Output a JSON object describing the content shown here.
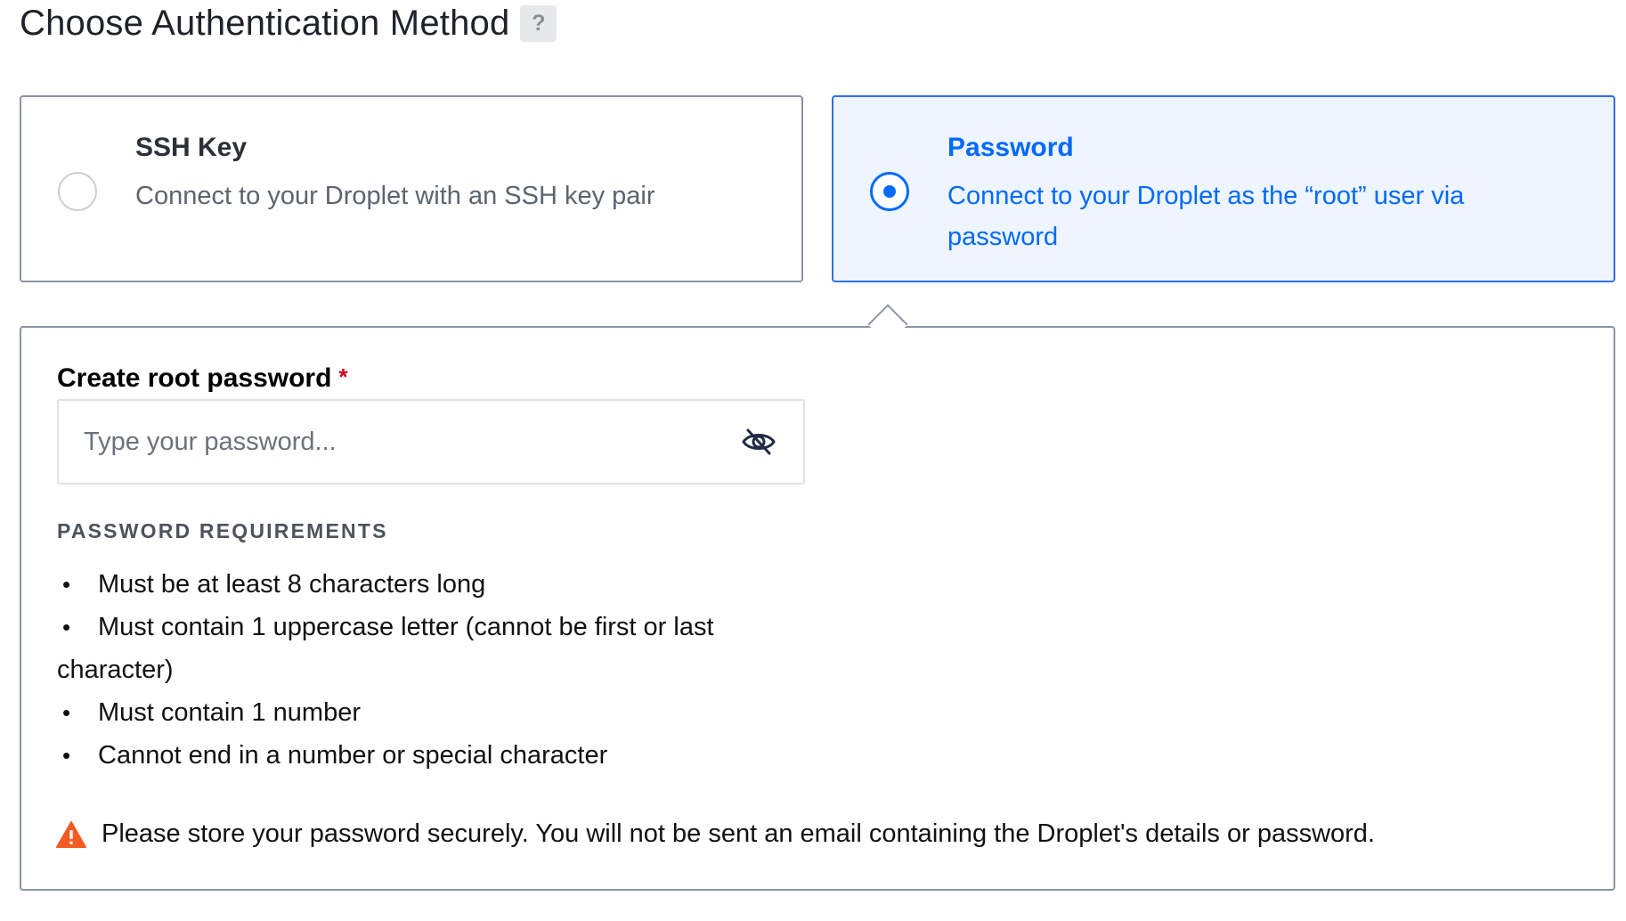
{
  "header": {
    "title": "Choose Authentication Method",
    "help_label": "?"
  },
  "auth_options": [
    {
      "title": "SSH Key",
      "description": "Connect to your Droplet with an SSH key pair",
      "selected": false
    },
    {
      "title": "Password",
      "description": "Connect to your Droplet as the “root” user via password",
      "selected": true
    }
  ],
  "password_form": {
    "label": "Create root password",
    "required_marker": "*",
    "placeholder": "Type your password...",
    "value": "",
    "toggle_icon": "eye-slash-icon",
    "requirements_heading": "PASSWORD REQUIREMENTS",
    "requirements": [
      "Must be at least 8 characters long",
      "Must contain 1 uppercase letter (cannot be first or last character)",
      "Must contain 1 number",
      "Cannot end in a number or special character"
    ],
    "bullet": "•",
    "warning_icon": "warning-triangle-icon",
    "warning": "Please store your password securely. You will not be sent an email containing the Droplet's details or password."
  },
  "colors": {
    "accent": "#0069ff",
    "selected_bg": "#eef5fe",
    "border": "#8b94a5",
    "warning": "#f25c22",
    "required": "#d0021b"
  }
}
